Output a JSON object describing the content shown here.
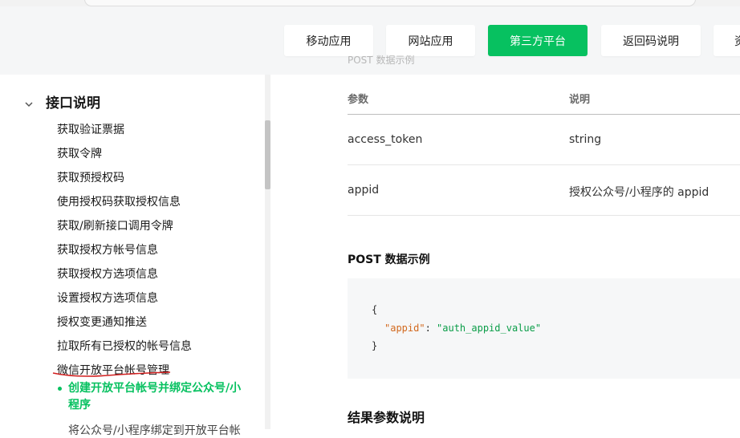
{
  "tabs": [
    {
      "label": "移动应用"
    },
    {
      "label": "网站应用"
    },
    {
      "label": "第三方平台"
    },
    {
      "label": "返回码说明"
    },
    {
      "label": "资"
    }
  ],
  "accent_color": "#07c160",
  "sidebar": {
    "section": {
      "title": "接口说明",
      "icon": "chevron-down-icon"
    },
    "items": [
      {
        "label": "获取验证票据"
      },
      {
        "label": "获取令牌"
      },
      {
        "label": "获取预授权码"
      },
      {
        "label": "使用授权码获取授权信息"
      },
      {
        "label": "获取/刷新接口调用令牌"
      },
      {
        "label": "获取授权方帐号信息"
      },
      {
        "label": "获取授权方选项信息"
      },
      {
        "label": "设置授权方选项信息"
      },
      {
        "label": "授权变更通知推送"
      },
      {
        "label": "拉取所有已授权的帐号信息"
      },
      {
        "label": "微信开放平台帐号管理"
      }
    ],
    "active_sub": {
      "label": "创建开放平台帐号并绑定公众号/小程序"
    },
    "next_sub": {
      "label": "将公众号/小程序绑定到开放平台帐"
    }
  },
  "main": {
    "faded_text": "POST 数据示例",
    "table": {
      "headers": {
        "param": "参数",
        "desc": "说明"
      },
      "rows": [
        {
          "param": "access_token",
          "desc": "string"
        },
        {
          "param": "appid",
          "desc": "授权公众号/小程序的 appid"
        }
      ]
    },
    "post_title": "POST 数据示例",
    "code": {
      "open": "{",
      "key": "\"appid\"",
      "sep": ": ",
      "value": "\"auth_appid_value\"",
      "close": "}"
    },
    "result_title": "结果参数说明"
  }
}
